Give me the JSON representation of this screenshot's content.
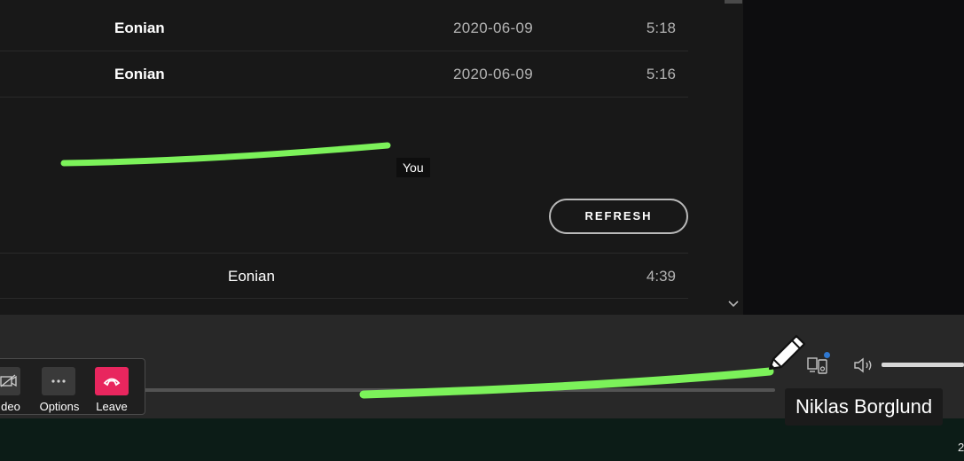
{
  "tracks": [
    {
      "album": "Eonian",
      "date": "2020-06-09",
      "duration": "5:18"
    },
    {
      "album": "Eonian",
      "date": "2020-06-09",
      "duration": "5:16"
    }
  ],
  "annotation": {
    "label": "You"
  },
  "refresh": {
    "label": "REFRESH"
  },
  "bottom_row": {
    "album": "Eonian",
    "duration": "4:39"
  },
  "meeting_controls": {
    "video_label": "deo",
    "options_label": "Options",
    "leave_label": "Leave",
    "leave_color": "#e8265e"
  },
  "presenter": {
    "name": "Niklas Borglund"
  },
  "taskbar": {
    "clock_fragment": "2"
  },
  "colors": {
    "annotation_stroke": "#7cf25a",
    "accent_blue": "#2e77d0"
  },
  "icons": [
    "skip-next-icon",
    "repeat-icon",
    "video-off-icon",
    "more-icon",
    "phone-hangup-icon",
    "connect-device-icon",
    "volume-icon",
    "pencil-icon",
    "chevron-down-icon"
  ]
}
